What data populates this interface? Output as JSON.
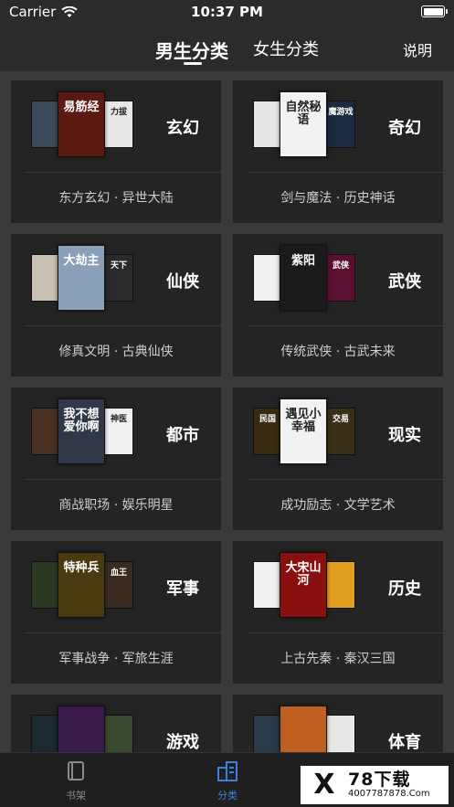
{
  "status": {
    "carrier": "Carrier",
    "time": "10:37 PM"
  },
  "nav": {
    "tab_male": "男生分类",
    "tab_female": "女生分类",
    "help": "说明"
  },
  "categories": [
    {
      "title": "玄幻",
      "subtitle": "东方玄幻 · 异世大陆",
      "covers": [
        "",
        "易筋经",
        "力拔"
      ]
    },
    {
      "title": "奇幻",
      "subtitle": "剑与魔法 · 历史神话",
      "covers": [
        "",
        "自然秘语",
        "魔游戏"
      ]
    },
    {
      "title": "仙侠",
      "subtitle": "修真文明 · 古典仙侠",
      "covers": [
        "",
        "大劫主",
        "天下"
      ]
    },
    {
      "title": "武侠",
      "subtitle": "传统武侠 · 古武未来",
      "covers": [
        "",
        "紫阳",
        "武侠"
      ]
    },
    {
      "title": "都市",
      "subtitle": "商战职场 · 娱乐明星",
      "covers": [
        "",
        "我不想爱你啊",
        "神医"
      ]
    },
    {
      "title": "现实",
      "subtitle": "成功励志 · 文学艺术",
      "covers": [
        "民国",
        "遇见小幸福",
        "交易"
      ]
    },
    {
      "title": "军事",
      "subtitle": "军事战争 · 军旅生涯",
      "covers": [
        "",
        "特种兵",
        "血王"
      ]
    },
    {
      "title": "历史",
      "subtitle": "上古先秦 · 秦汉三国",
      "covers": [
        "",
        "大宋山河",
        ""
      ]
    },
    {
      "title": "游戏",
      "subtitle": "",
      "covers": [
        "",
        "",
        ""
      ]
    },
    {
      "title": "体育",
      "subtitle": "",
      "covers": [
        "",
        "",
        ""
      ]
    }
  ],
  "cover_colors": [
    [
      "#3a4a5a",
      "#5a1a12",
      "#e8e8e8"
    ],
    [
      "#e6e6e6",
      "#f2f2f2",
      "#1a2a40"
    ],
    [
      "#c8c0b0",
      "#8aa0b8",
      "#2a2a2a"
    ],
    [
      "#f0f0f0",
      "#1a1a1a",
      "#5a1030"
    ],
    [
      "#4a3020",
      "#303848",
      "#f0f0f0"
    ],
    [
      "#3a2a10",
      "#f2f2f2",
      "#3a3018"
    ],
    [
      "#2a3a20",
      "#4a3a10",
      "#3a2a20"
    ],
    [
      "#f0f0f0",
      "#8a1010",
      "#e0a020"
    ],
    [
      "#1a2a30",
      "#3a1a4a",
      "#3a4a30"
    ],
    [
      "#2a3a4a",
      "#c06020",
      "#e8e8e8"
    ]
  ],
  "tabbar": {
    "shelf": "书架",
    "category": "分类"
  },
  "watermark": {
    "logo": "X",
    "title": "78下载",
    "url": "4007787878.Com"
  },
  "colors": {
    "accent": "#3d7fe0",
    "card_bg": "#242424",
    "page_bg": "#3a3a3a"
  }
}
